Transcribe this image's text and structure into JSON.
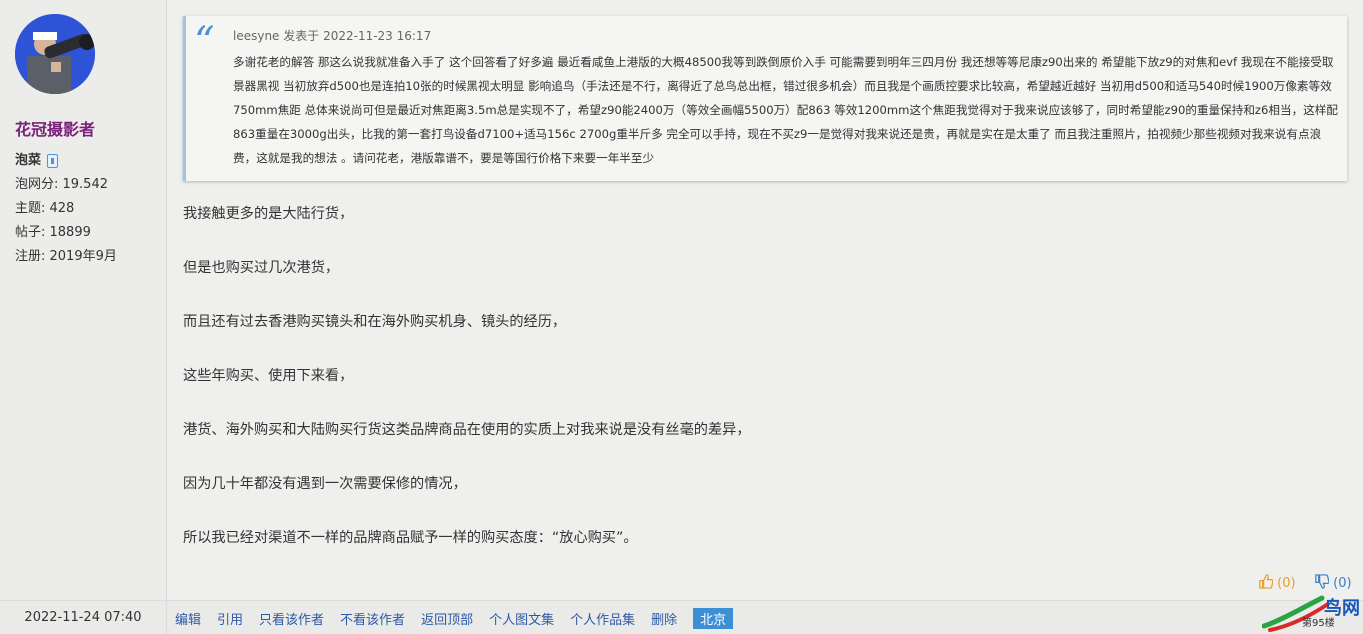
{
  "user": {
    "name": "花冠摄影者",
    "rank": "泡菜",
    "score": "泡网分: 19.542",
    "topics": "主题: 428",
    "posts": "帖子: 18899",
    "registered": "注册: 2019年9月"
  },
  "quote": {
    "header": "leesyne 发表于 2022-11-23 16:17",
    "body": "多谢花老的解答 那这么说我就准备入手了 这个回答看了好多遍 最近看咸鱼上港版的大概48500我等到跌倒原价入手 可能需要到明年三四月份 我还想等等尼康z90出来的 希望能下放z9的对焦和evf 我现在不能接受取景器黑视 当初放弃d500也是连拍10张的时候黑视太明显 影响追鸟（手法还是不行，离得近了总鸟总出框，错过很多机会）而且我是个画质控要求比较高，希望越近越好 当初用d500和适马540时候1900万像素等效750mm焦距 总体来说尚可但是最近对焦距离3.5m总是实现不了，希望z90能2400万（等效全画幅5500万）配863 等效1200mm这个焦距我觉得对于我来说应该够了，同时希望能z90的重量保持和z6相当，这样配863重量在3000g出头，比我的第一套打鸟设备d7100+适马156c 2700g重半斤多 完全可以手持，现在不买z9一是觉得对我来说还是贵，再就是实在是太重了 而且我注重照片，拍视频少那些视频对我来说有点浪费，这就是我的想法 。请问花老，港版靠谱不，要是等国行价格下来要一年半至少"
  },
  "paragraphs": [
    "我接触更多的是大陆行货，",
    "但是也购买过几次港货，",
    "而且还有过去香港购买镜头和在海外购买机身、镜头的经历，",
    "这些年购买、使用下来看，",
    "港货、海外购买和大陆购买行货这类品牌商品在使用的实质上对我来说是没有丝毫的差异，",
    "因为几十年都没有遇到一次需要保修的情况，",
    "所以我已经对渠道不一样的品牌商品赋予一样的购买态度：“放心购买”。"
  ],
  "reactions": {
    "up": "(0)",
    "down": "(0)"
  },
  "footer": {
    "date": "2022-11-24 07:40",
    "actions": [
      "编辑",
      "引用",
      "只看该作者",
      "不看该作者",
      "返回顶部",
      "个人图文集",
      "个人作品集",
      "删除"
    ],
    "location": "北京"
  },
  "logo": {
    "text": "鸟网",
    "subtext": "第95楼"
  },
  "colors": {
    "username": "#7a1f7a",
    "link": "#2c5aa8",
    "quote_accent": "#4e8fd0",
    "location_bg": "#3c8fd5"
  }
}
